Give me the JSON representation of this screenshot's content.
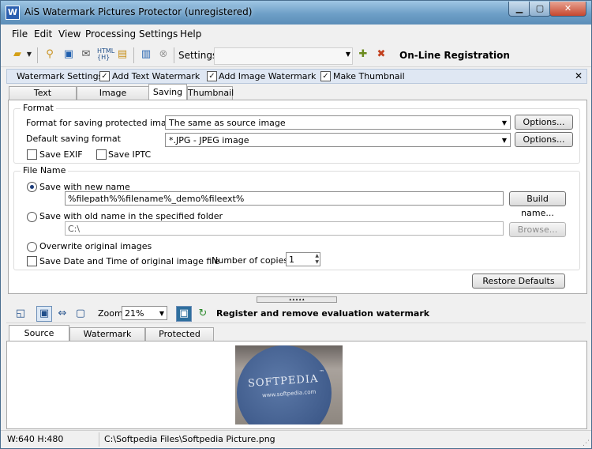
{
  "window": {
    "title": "AiS Watermark Pictures Protector (unregistered)",
    "app_icon_glyph": "W",
    "minimize_glyph": "▁",
    "maximize_glyph": "▢",
    "close_glyph": "✕"
  },
  "menu": [
    "File",
    "Edit",
    "View",
    "Processing",
    "Settings",
    "Help"
  ],
  "toolbar": {
    "settings_label": "Settings",
    "settings_value": "",
    "registration_label": "On-Line Registration",
    "icons": [
      "open-folder-icon",
      "dropdown-arrow-icon",
      "preview-icon",
      "save-icon",
      "email-icon",
      "html-icon",
      "lock-icon",
      "copy-icon",
      "delete-icon",
      "add-settings-icon",
      "remove-settings-icon"
    ]
  },
  "watermark_settings": {
    "label": "Watermark Settings:",
    "options": [
      {
        "label": "Add Text Watermark",
        "checked": true
      },
      {
        "label": "Add Image Watermark",
        "checked": true
      },
      {
        "label": "Make Thumbnail",
        "checked": true
      }
    ],
    "close_glyph": "✕"
  },
  "tabs": [
    {
      "label": "Text watermark",
      "active": false
    },
    {
      "label": "Image watermark",
      "active": false
    },
    {
      "label": "Saving",
      "active": true
    },
    {
      "label": "Thumbnail",
      "active": false
    }
  ],
  "saving": {
    "format_group": "Format",
    "format_label": "Format for saving protected images",
    "format_value": "The same as source image",
    "default_format_label": "Default saving format",
    "default_format_value": "*.JPG - JPEG image",
    "options_label": "Options...",
    "save_exif": {
      "label": "Save EXIF",
      "checked": false
    },
    "save_iptc": {
      "label": "Save IPTC",
      "checked": false
    },
    "filename_group": "File Name",
    "save_new_name": {
      "label": "Save with new name",
      "selected": true
    },
    "new_name_pattern": "%filepath%%filename%_demo%fileext%",
    "build_name_label": "Build name...",
    "save_old_name": {
      "label": "Save with old name in the specified folder",
      "selected": false
    },
    "folder_value": "C:\\",
    "browse_label": "Browse...",
    "overwrite": {
      "label": "Overwrite original images",
      "selected": false
    },
    "save_date": {
      "label": "Save Date and Time of original image file",
      "checked": false
    },
    "copies_label": "Number of copies:",
    "copies_value": "1",
    "restore_label": "Restore Defaults"
  },
  "viewbar": {
    "zoom_label": "Zoom",
    "zoom_value": "21%",
    "register_label": "Register and remove evaluation watermark"
  },
  "image_tabs": [
    {
      "label": "Source image",
      "active": true
    },
    {
      "label": "Watermark image",
      "active": false
    },
    {
      "label": "Protected image",
      "active": false
    }
  ],
  "preview": {
    "text": "SOFTPEDIA",
    "subtext": "www.softpedia.com",
    "trademark": "™"
  },
  "status": {
    "dimensions": "W:640 H:480",
    "path": "C:\\Softpedia Files\\Softpedia Picture.png"
  }
}
